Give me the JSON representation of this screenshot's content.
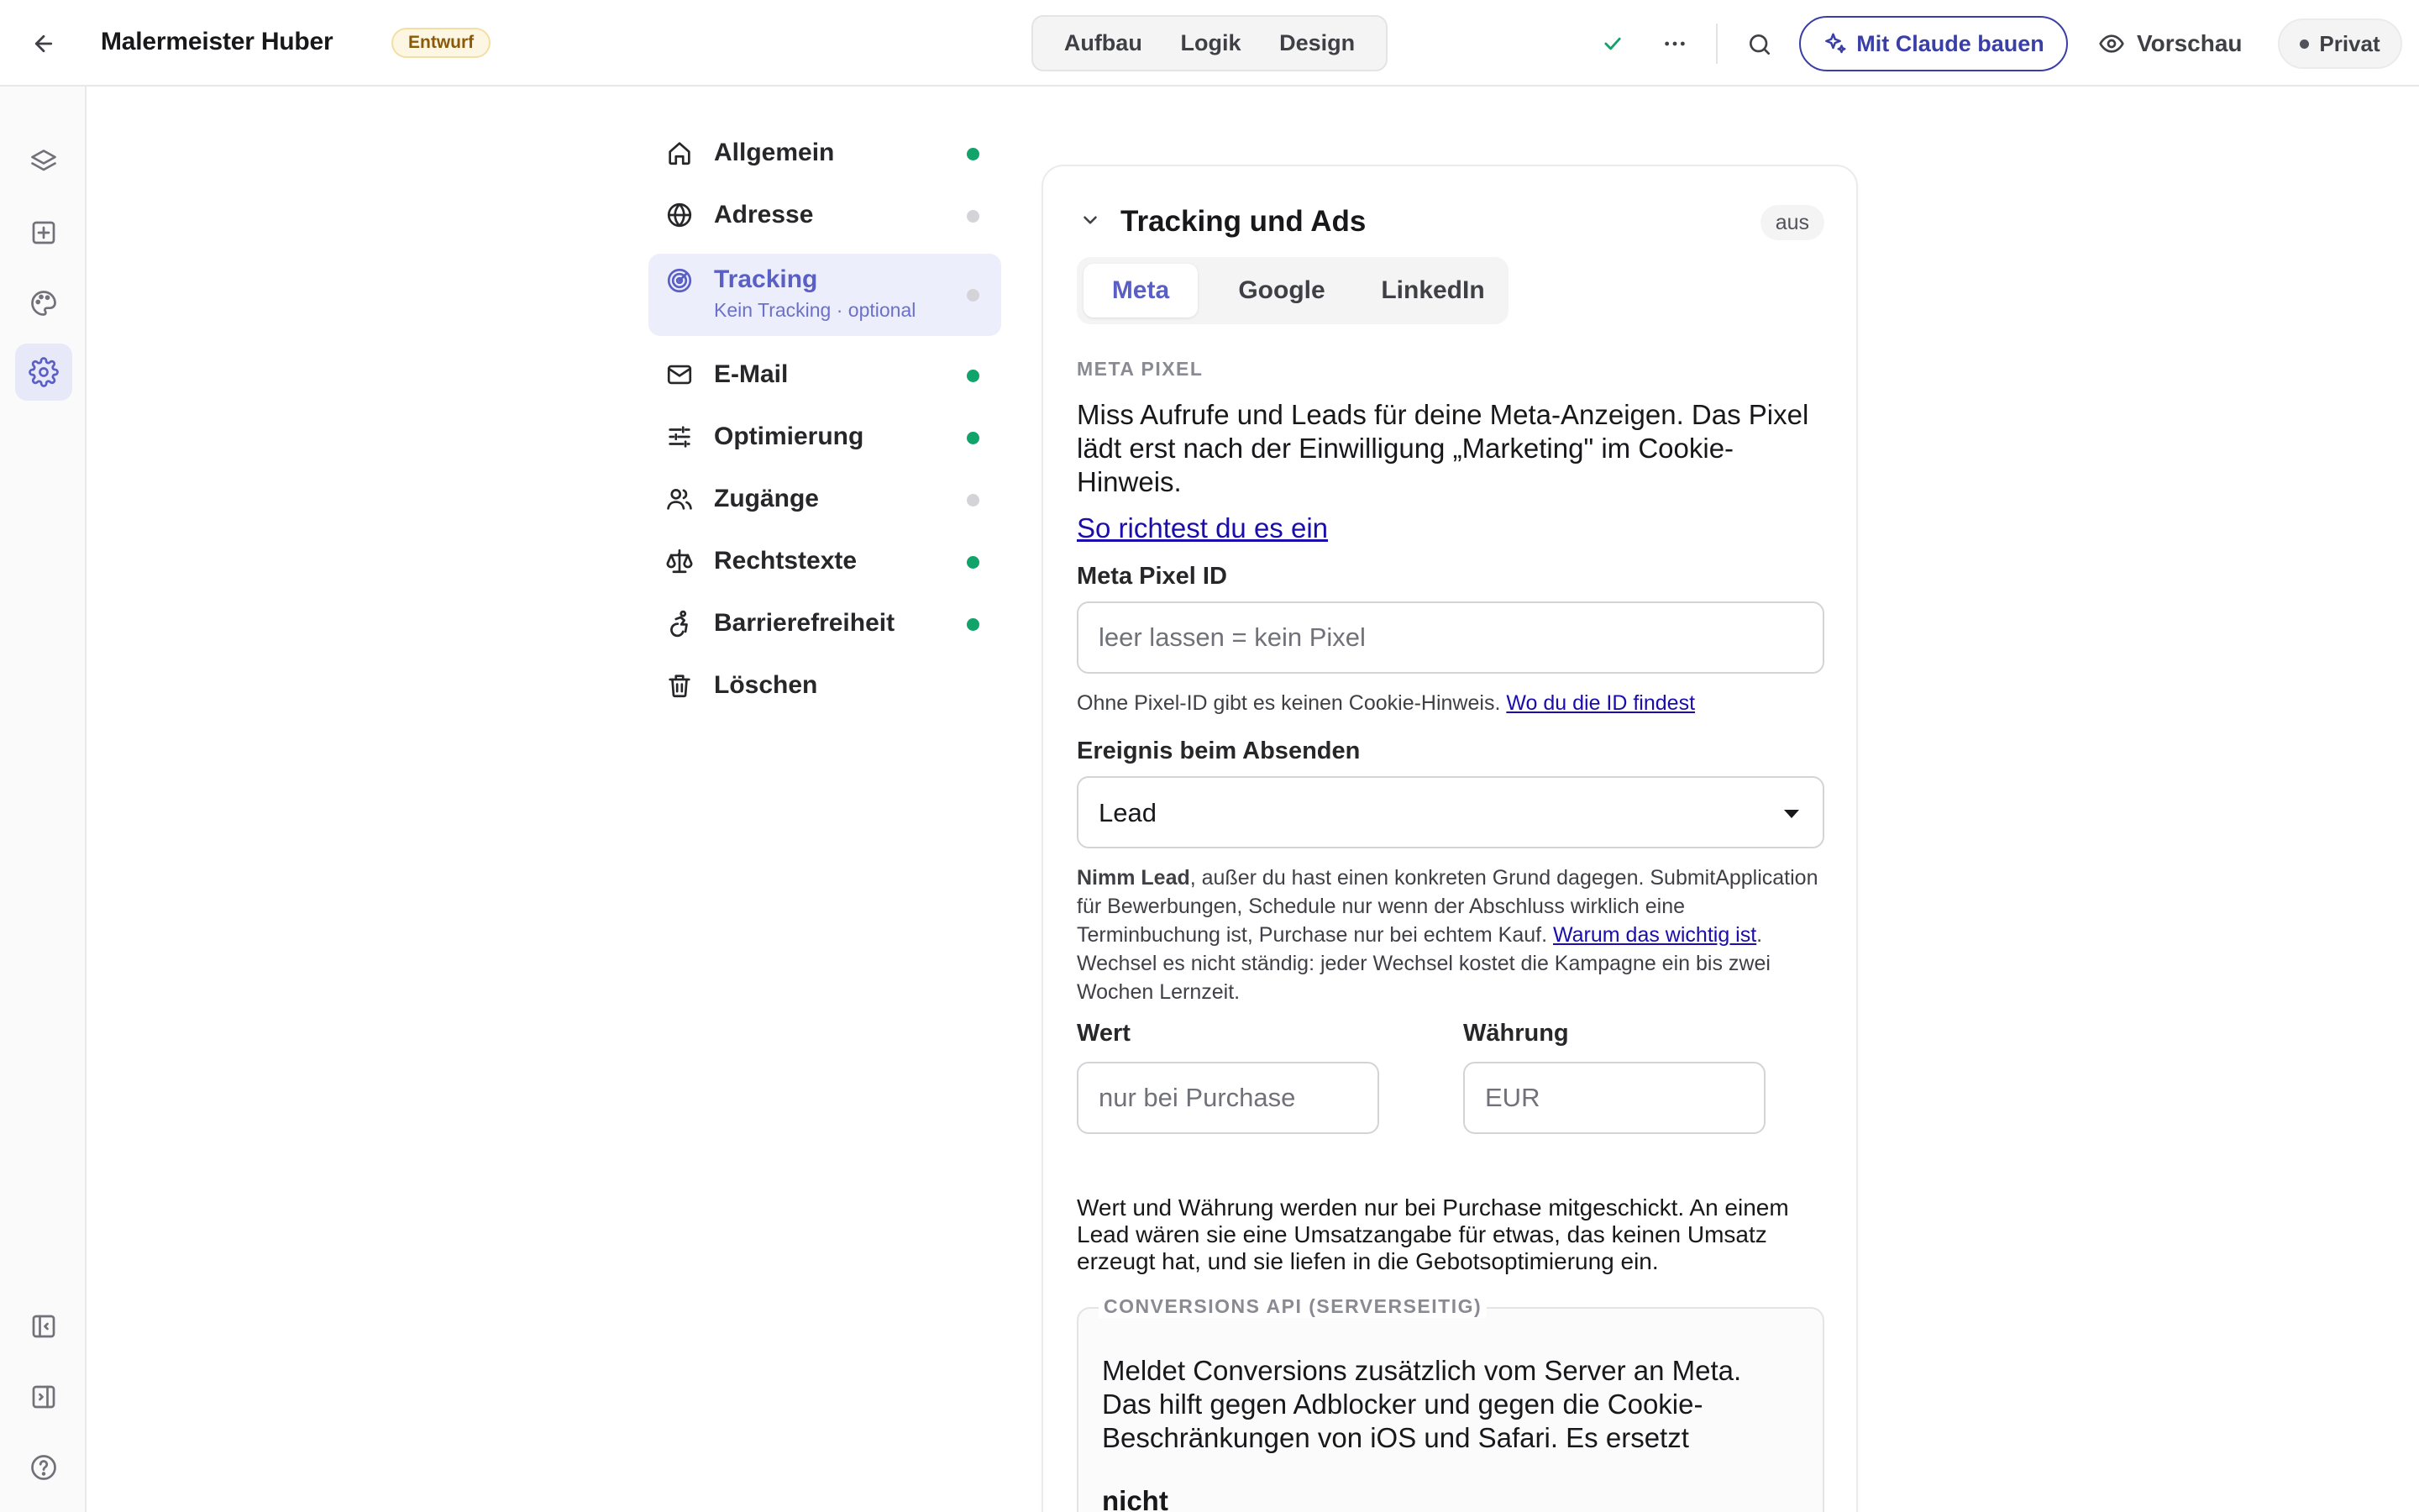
{
  "header": {
    "title": "Malermeister Huber",
    "status_badge": "Entwurf",
    "modes": [
      "Aufbau",
      "Logik",
      "Design"
    ],
    "claude_button": "Mit Claude bauen",
    "preview_button": "Vorschau",
    "visibility_button": "Privat"
  },
  "nav": {
    "items": [
      {
        "label": "Allgemein",
        "icon": "home-icon",
        "status": "green"
      },
      {
        "label": "Adresse",
        "icon": "globe-icon",
        "status": "grey"
      },
      {
        "label": "Tracking",
        "sublabel": "Kein Tracking · optional",
        "icon": "radar-icon",
        "status": "grey",
        "active": true
      },
      {
        "label": "E-Mail",
        "icon": "mail-icon",
        "status": "green"
      },
      {
        "label": "Optimierung",
        "icon": "sliders-icon",
        "status": "green"
      },
      {
        "label": "Zugänge",
        "icon": "users-icon",
        "status": "grey"
      },
      {
        "label": "Rechtstexte",
        "icon": "scale-icon",
        "status": "green"
      },
      {
        "label": "Barrierefreiheit",
        "icon": "accessibility-icon",
        "status": "green"
      },
      {
        "label": "Löschen",
        "icon": "trash-icon"
      }
    ]
  },
  "card": {
    "title": "Tracking und Ads",
    "state_badge": "aus",
    "tabs": [
      "Meta",
      "Google",
      "LinkedIn"
    ],
    "active_tab": "Meta",
    "section_label": "META PIXEL",
    "description": "Miss Aufrufe und Leads für deine Meta-Anzeigen. Das Pixel lädt erst nach der Einwilligung „Marketing\" im Cookie-Hinweis.",
    "setup_link": "So richtest du es ein",
    "pixel_id": {
      "label": "Meta Pixel ID",
      "value": "",
      "placeholder": "leer lassen = kein Pixel",
      "help": "Ohne Pixel-ID gibt es keinen Cookie-Hinweis.",
      "help_link": "Wo du die ID findest"
    },
    "event": {
      "label": "Ereignis beim Absenden",
      "value": "Lead",
      "help_bold": "Nimm Lead",
      "help_part1": ", außer du hast einen konkreten Grund dagegen. SubmitApplication für Bewerbungen, Schedule nur wenn der Abschluss wirklich eine Terminbuchung ist, Purchase nur bei echtem Kauf.",
      "help_link": "Warum das wichtig ist",
      "help_part2": ". Wechsel es nicht ständig: jeder Wechsel kostet die Kampagne ein bis zwei Wochen Lernzeit."
    },
    "value_field": {
      "label": "Wert",
      "value": "",
      "placeholder": "nur bei Purchase"
    },
    "currency_field": {
      "label": "Währung",
      "value": "",
      "placeholder": "EUR"
    },
    "purchase_note": "Wert und Währung werden nur bei Purchase mitgeschickt. An einem Lead wären sie eine Umsatzangabe für etwas, das keinen Umsatz erzeugt hat, und sie liefen in die Gebotsoptimierung ein.",
    "capi": {
      "label": "CONVERSIONS API (SERVERSEITIG)",
      "text": "Meldet Conversions zusätzlich vom Server an Meta. Das hilft gegen Adblocker und gegen die Cookie-Beschränkungen von iOS und Safari. Es ersetzt",
      "emphasis": "nicht"
    }
  },
  "colors": {
    "accent": "#5a5fc6",
    "claude_button": "#3a3fa8",
    "status_green": "#10a36a",
    "status_grey": "#d4d4d8",
    "link": "#1a0dab"
  }
}
